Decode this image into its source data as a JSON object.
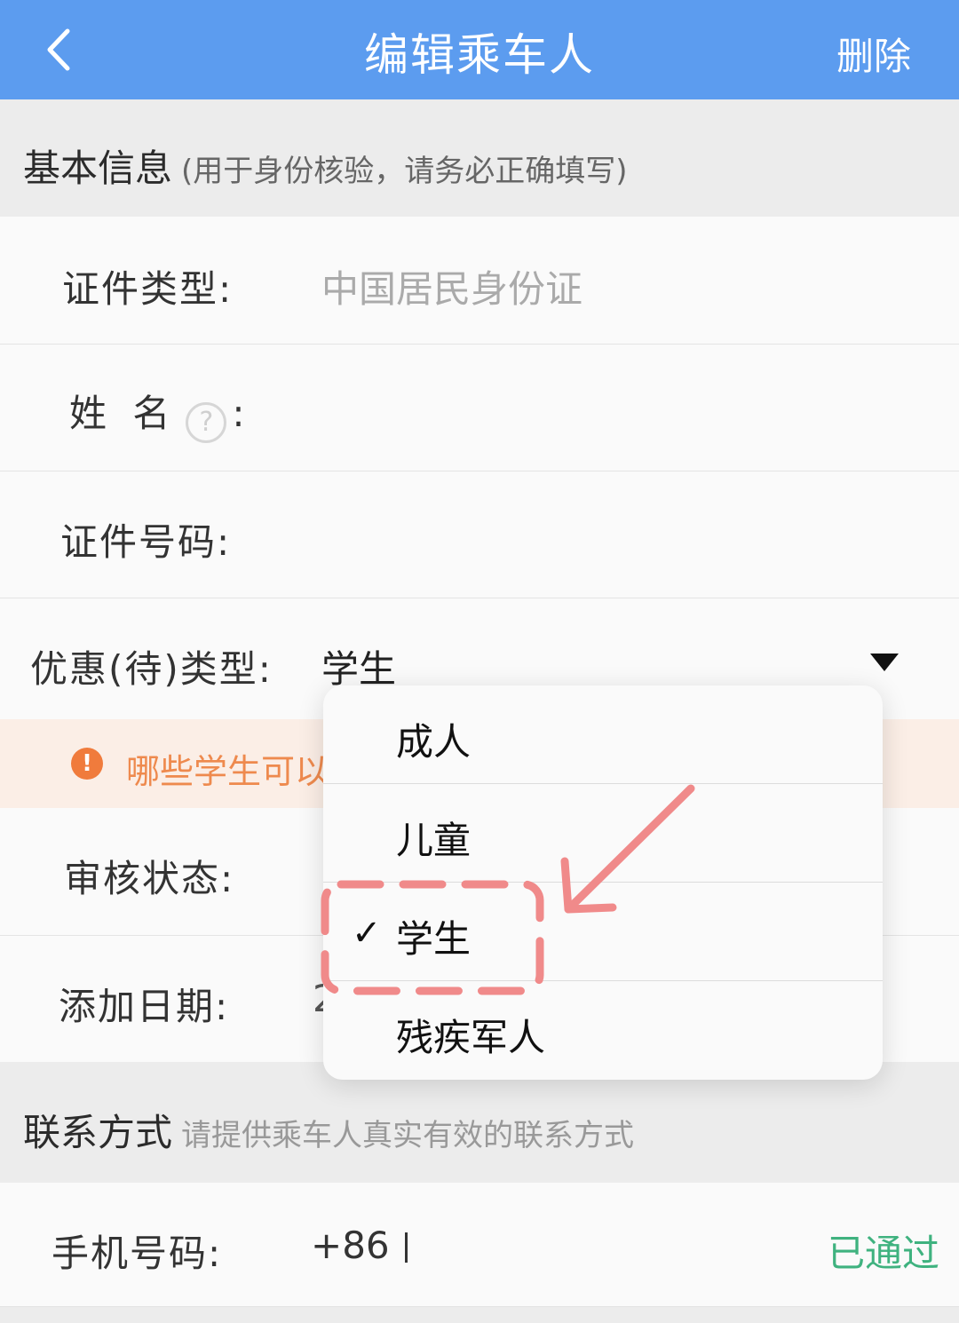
{
  "navbar": {
    "title": "编辑乘车人",
    "delete_label": "删除"
  },
  "basic_info": {
    "title": "基本信息",
    "subtitle": "(用于身份核验，请务必正确填写)"
  },
  "fields": {
    "id_type": {
      "label": "证件类型:",
      "value": "中国居民身份证"
    },
    "name": {
      "label": "姓 名",
      "help": "?",
      "colon": ":"
    },
    "id_number": {
      "label": "证件号码:"
    },
    "discount_type": {
      "label": "优惠(待)类型:",
      "value": "学生"
    },
    "notice": {
      "text": "哪些学生可以"
    },
    "review_status": {
      "label": "审核状态:"
    },
    "add_date": {
      "label": "添加日期:",
      "value_partial": "2"
    }
  },
  "dropdown": {
    "options": [
      {
        "label": "成人",
        "selected": false
      },
      {
        "label": "儿童",
        "selected": false
      },
      {
        "label": "学生",
        "selected": true
      },
      {
        "label": "残疾军人",
        "selected": false
      }
    ],
    "check_mark": "✓"
  },
  "contact": {
    "title": "联系方式",
    "subtitle": "请提供乘车人真实有效的联系方式",
    "phone_label": "手机号码:",
    "phone_prefix": "+86",
    "verified": "已通过"
  },
  "colors": {
    "nav_bg": "#5c9cef",
    "annotation": "#f08a8a",
    "verified": "#3fb27f",
    "notice_text": "#ee8a4e"
  }
}
